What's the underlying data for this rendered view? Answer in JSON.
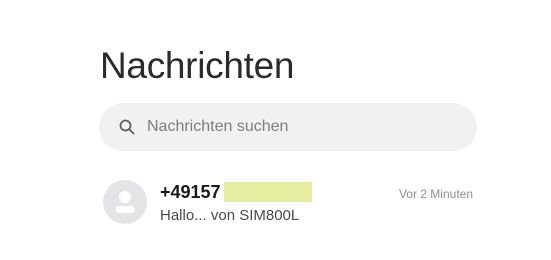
{
  "header": {
    "title": "Nachrichten"
  },
  "search": {
    "placeholder": "Nachrichten suchen",
    "icon": "search-icon"
  },
  "conversations": [
    {
      "sender": "+49157",
      "snippet": "Hallo... von SIM800L",
      "timestamp": "Vor 2 Minuten",
      "avatar_icon": "person-icon"
    }
  ],
  "colors": {
    "background": "#ffffff",
    "search_background": "#f1f1f1",
    "avatar_background": "#e4e4e6",
    "redaction": "#e6eda0"
  }
}
